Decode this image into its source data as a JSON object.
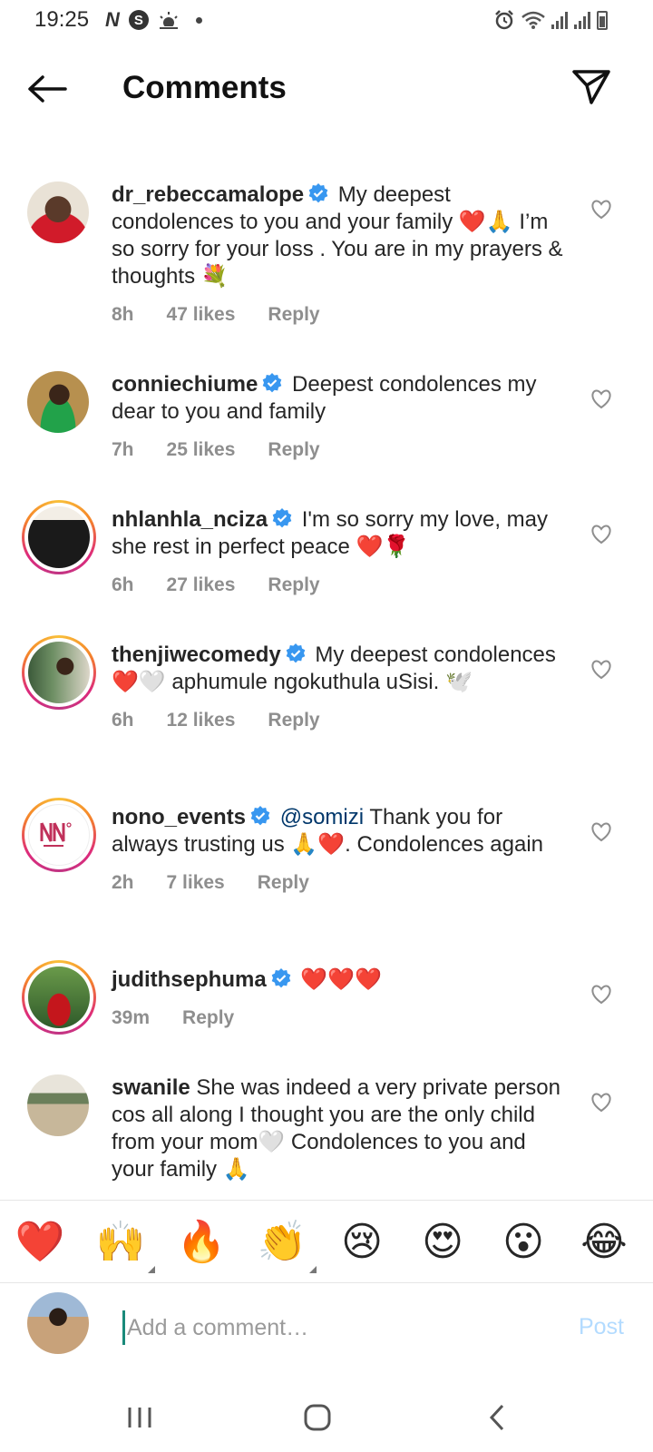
{
  "status_bar": {
    "time": "19:25",
    "left_icons": [
      "netflix-n-icon",
      "s-app-icon",
      "weather-icon",
      "notification-dot"
    ],
    "right_icons": [
      "alarm-icon",
      "wifi-icon",
      "signal-icon",
      "signal-icon",
      "battery-icon"
    ],
    "n_glyph": "N",
    "s_glyph": "S"
  },
  "header": {
    "title": "Comments",
    "back_icon": "arrow-left-icon",
    "share_icon": "paper-plane-icon"
  },
  "comments": [
    {
      "username": "dr_rebeccamalope",
      "verified": true,
      "text": "My deepest condolences to you and your family ❤️🙏 I’m so sorry for your loss . You are in my prayers & thoughts 💐",
      "time": "8h",
      "likes": "47 likes",
      "reply": "Reply"
    },
    {
      "username": "conniechiume",
      "verified": true,
      "text": "Deepest condolences my dear to you and family",
      "time": "7h",
      "likes": "25 likes",
      "reply": "Reply"
    },
    {
      "username": "nhlanhla_nciza",
      "verified": true,
      "text": "I'm so sorry my love, may she rest in perfect peace ❤️🌹",
      "time": "6h",
      "likes": "27 likes",
      "reply": "Reply"
    },
    {
      "username": "thenjiwecomedy",
      "verified": true,
      "text": "My deepest condolences ❤️🤍 aphumule ngokuthula uSisi. 🕊️",
      "time": "6h",
      "likes": "12 likes",
      "reply": "Reply"
    },
    {
      "username": "nono_events",
      "verified": true,
      "mention": "@somizi",
      "text": "Thank you for always trusting us 🙏❤️. Condolences again",
      "time": "2h",
      "likes": "7 likes",
      "reply": "Reply"
    },
    {
      "username": "judithsephuma",
      "verified": true,
      "text": "❤️❤️❤️",
      "time": "39m",
      "reply": "Reply"
    },
    {
      "username": "swanile",
      "verified": false,
      "text": "She was indeed a very private person cos all along I thought you are the only child from your mom🤍 Condolences to you and your family 🙏"
    }
  ],
  "reactions": [
    "❤️",
    "🙌",
    "🔥",
    "👏",
    "😢",
    "😍",
    "😮",
    "😂"
  ],
  "composer": {
    "placeholder": "Add a comment…",
    "post_label": "Post"
  },
  "nav_bar": {
    "icons": [
      "recent-apps-icon",
      "home-icon",
      "back-icon"
    ]
  },
  "colors": {
    "verified": "#3897f0",
    "post_disabled": "#b3dbff",
    "meta": "#8e8e8e",
    "mention": "#00376b"
  }
}
